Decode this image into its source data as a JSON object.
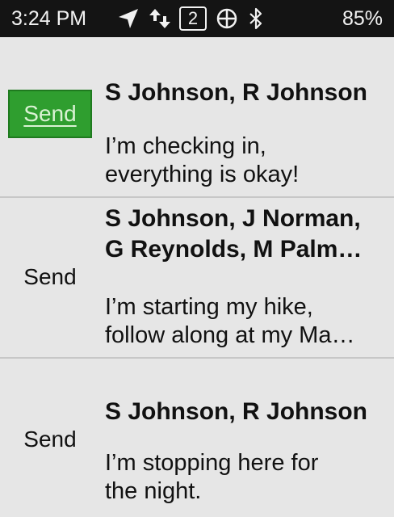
{
  "status": {
    "time": "3:24 PM",
    "notification_count": "2",
    "battery": "85%"
  },
  "messages": [
    {
      "send_label": "Send",
      "recipients": [
        "S Johnson, R Johnson"
      ],
      "message_lines": [
        "I’m checking in,",
        "everything is okay!"
      ]
    },
    {
      "send_label": "Send",
      "recipients": [
        "S Johnson, J Norman,",
        "G Reynolds, M Palm…"
      ],
      "message_lines": [
        "I’m starting my hike,",
        "follow along at my Ma…"
      ]
    },
    {
      "send_label": "Send",
      "recipients": [
        "S Johnson, R Johnson"
      ],
      "message_lines": [
        "I’m stopping here for",
        "the night."
      ]
    }
  ]
}
